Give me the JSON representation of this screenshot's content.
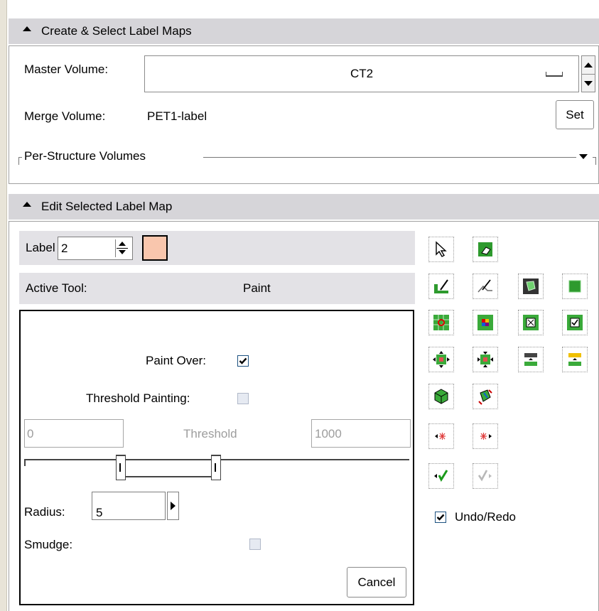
{
  "section1": {
    "title": "Create & Select Label Maps",
    "master_label": "Master Volume:",
    "master_value": "CT2",
    "merge_label": "Merge Volume:",
    "merge_value": "PET1-label",
    "set_button": "Set",
    "per_structure_label": "Per-Structure Volumes"
  },
  "section2": {
    "title": "Edit Selected Label Map",
    "label_text": "Label",
    "label_value": "2",
    "label_color": "#f9c6ad",
    "active_tool_label": "Active Tool:",
    "active_tool_value": "Paint",
    "paint_over_label": "Paint Over:",
    "paint_over_checked": true,
    "threshold_painting_label": "Threshold Painting:",
    "threshold_painting_checked": false,
    "threshold_min": "0",
    "threshold_label": "Threshold",
    "threshold_max": "1000",
    "radius_label": "Radius:",
    "radius_value": "5",
    "smudge_label": "Smudge:",
    "smudge_checked": false,
    "cancel_button": "Cancel",
    "undo_redo_label": "Undo/Redo",
    "undo_redo_checked": true
  },
  "toolbox": {
    "tools": [
      "pointer-tool-icon",
      "erase-label-tool-icon",
      "paint-tool-icon",
      "draw-tool-icon",
      "level-tracing-tool-icon",
      "rectangle-tool-icon",
      "change-island-tool-icon",
      "identify-islands-tool-icon",
      "remove-islands-tool-icon",
      "save-island-tool-icon",
      "dilate-tool-icon",
      "erode-tool-icon",
      "change-label-tool-icon",
      "threshold-tool-icon",
      "make-model-tool-icon",
      "growcut-tool-icon",
      "previous-check-point-icon",
      "next-check-point-icon",
      "undo-icon",
      "redo-icon"
    ]
  },
  "colors": {
    "header_bg": "#d6d5d9",
    "tool_green": "#2e9a2e",
    "label_swatch": "#f9c6ad"
  }
}
